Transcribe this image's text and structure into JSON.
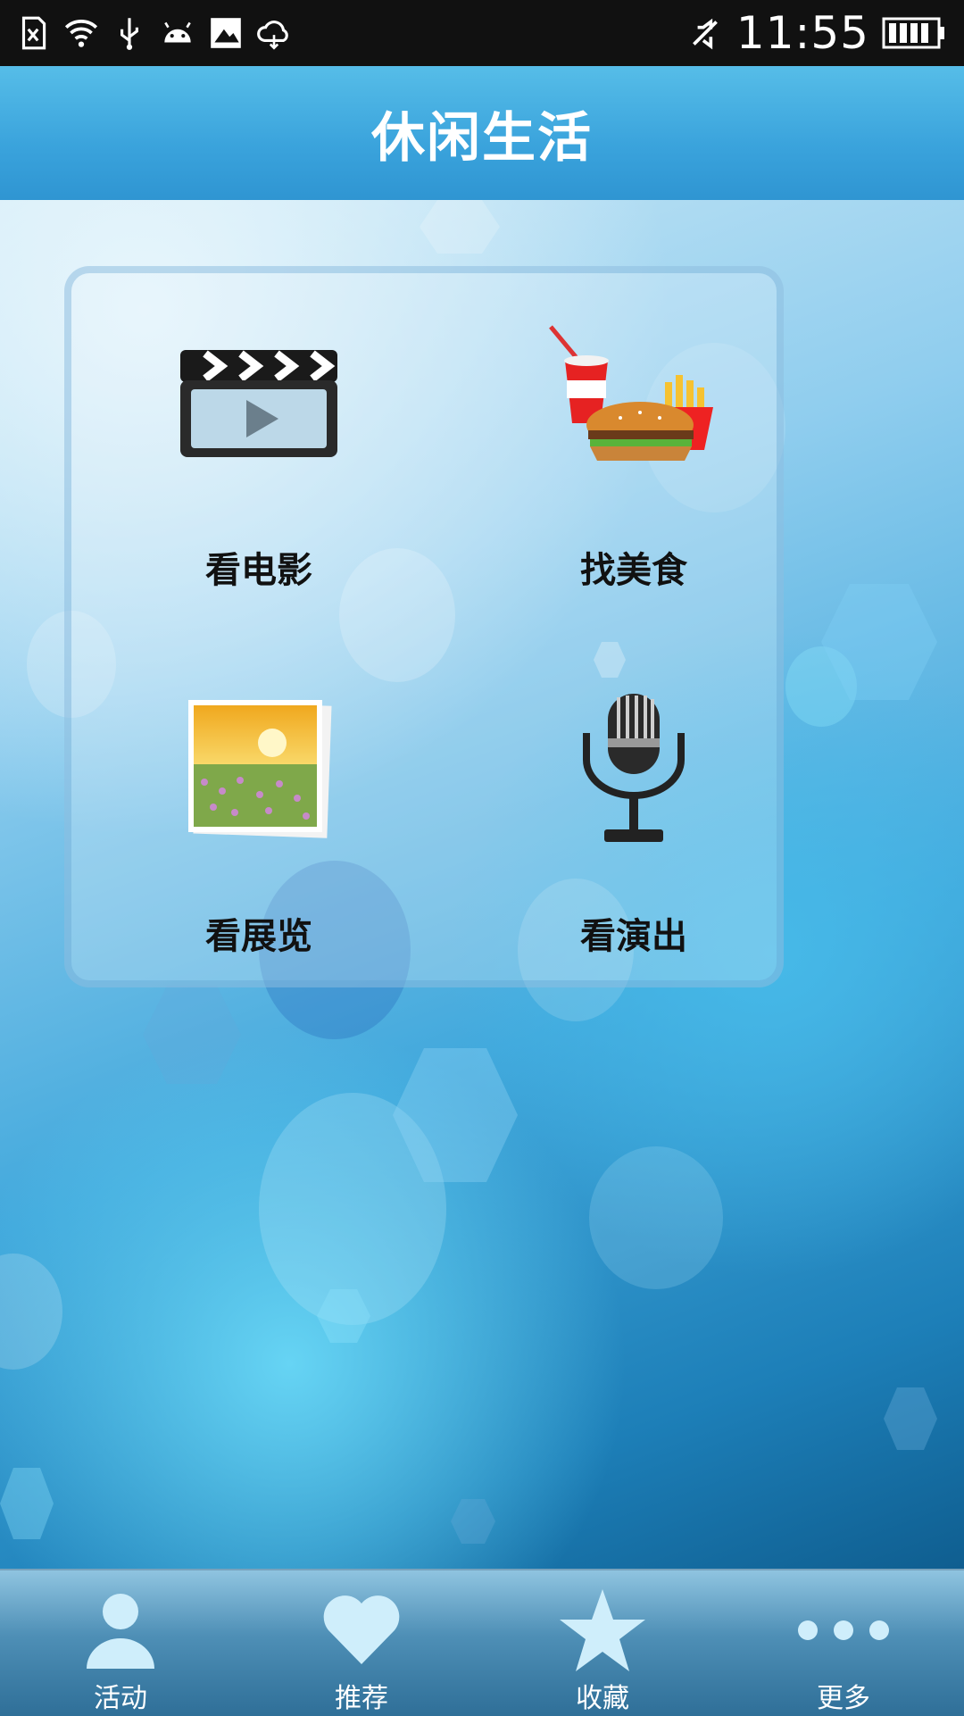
{
  "status_bar": {
    "time": "11:55",
    "icons": [
      "sd-card-error-icon",
      "wifi-icon",
      "usb-icon",
      "android-debug-icon",
      "image-notification-icon",
      "cloud-sync-icon",
      "mute-icon",
      "battery-icon"
    ]
  },
  "header": {
    "title": "休闲生活"
  },
  "grid": {
    "items": [
      {
        "label": "看电影",
        "icon": "movie-clapper-icon"
      },
      {
        "label": "找美食",
        "icon": "fast-food-icon"
      },
      {
        "label": "看展览",
        "icon": "photo-landscape-icon"
      },
      {
        "label": "看演出",
        "icon": "microphone-icon"
      }
    ]
  },
  "nav": {
    "items": [
      {
        "label": "活动",
        "icon": "person-icon"
      },
      {
        "label": "推荐",
        "icon": "heart-icon"
      },
      {
        "label": "收藏",
        "icon": "star-icon"
      },
      {
        "label": "更多",
        "icon": "more-dots-icon"
      }
    ]
  },
  "colors": {
    "header": "#3aa3dc",
    "nav": "#4e8fb6",
    "status_bar": "#111111"
  }
}
